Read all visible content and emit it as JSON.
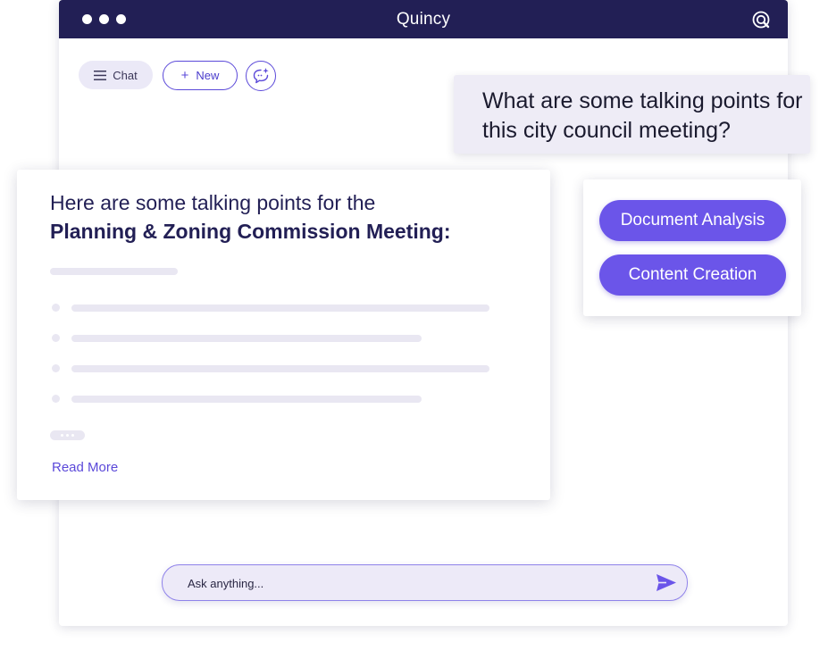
{
  "app": {
    "title": "Quincy"
  },
  "toolbar": {
    "chat_label": "Chat",
    "new_label": "New"
  },
  "question": {
    "text": "What are some talking points for this city council meeting?"
  },
  "response": {
    "intro": "Here are some talking points for the",
    "title": "Planning & Zoning Commission Meeting:",
    "read_more": "Read More"
  },
  "suggestions": [
    {
      "label": "Document Analysis"
    },
    {
      "label": "Content Creation"
    }
  ],
  "input": {
    "placeholder": "Ask anything..."
  },
  "icons": {
    "window_controls": "three-dots",
    "logo": "quincy-logo-icon",
    "chat": "menu-icon",
    "new": "plus-icon",
    "ai": "chat-sparkle-icon",
    "send": "send-icon"
  },
  "colors": {
    "header": "#221f55",
    "accent": "#6b55e9",
    "placeholder": "#e9e7f2"
  }
}
